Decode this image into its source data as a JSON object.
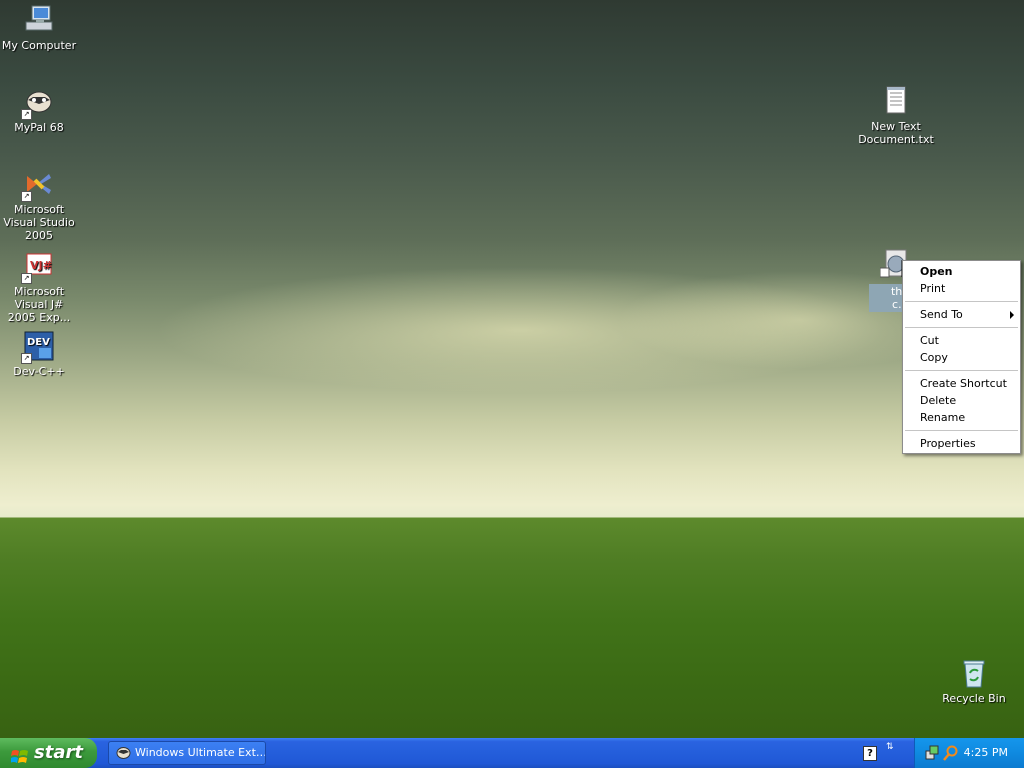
{
  "desktop": {
    "icons": [
      {
        "label": "My Computer",
        "icon": "computer-icon"
      },
      {
        "label": "MyPal 68",
        "icon": "mypal-icon"
      },
      {
        "label": "Microsoft Visual Studio 2005",
        "icon": "visual-studio-icon"
      },
      {
        "label": "Microsoft Visual J# 2005 Exp...",
        "icon": "visual-jsharp-icon"
      },
      {
        "label": "Dev-C++",
        "icon": "dev-cpp-icon"
      },
      {
        "label": "New Text Document.txt",
        "icon": "text-document-icon"
      },
      {
        "label": "Recycle Bin",
        "icon": "recycle-bin-icon"
      }
    ],
    "selected_icon_label": "the c… homep…"
  },
  "context_menu": {
    "items": [
      "Open",
      "Print",
      "Send To",
      "Cut",
      "Copy",
      "Create Shortcut",
      "Delete",
      "Rename",
      "Properties"
    ]
  },
  "taskbar": {
    "start_label": "start",
    "task_button_label": "Windows Ultimate Ext…",
    "clock": "4:25 PM"
  },
  "colors": {
    "taskbar": "#245edb",
    "start_button": "#3c9a3c",
    "tray": "#0f8ae0",
    "selection": "#8ea6b4"
  }
}
